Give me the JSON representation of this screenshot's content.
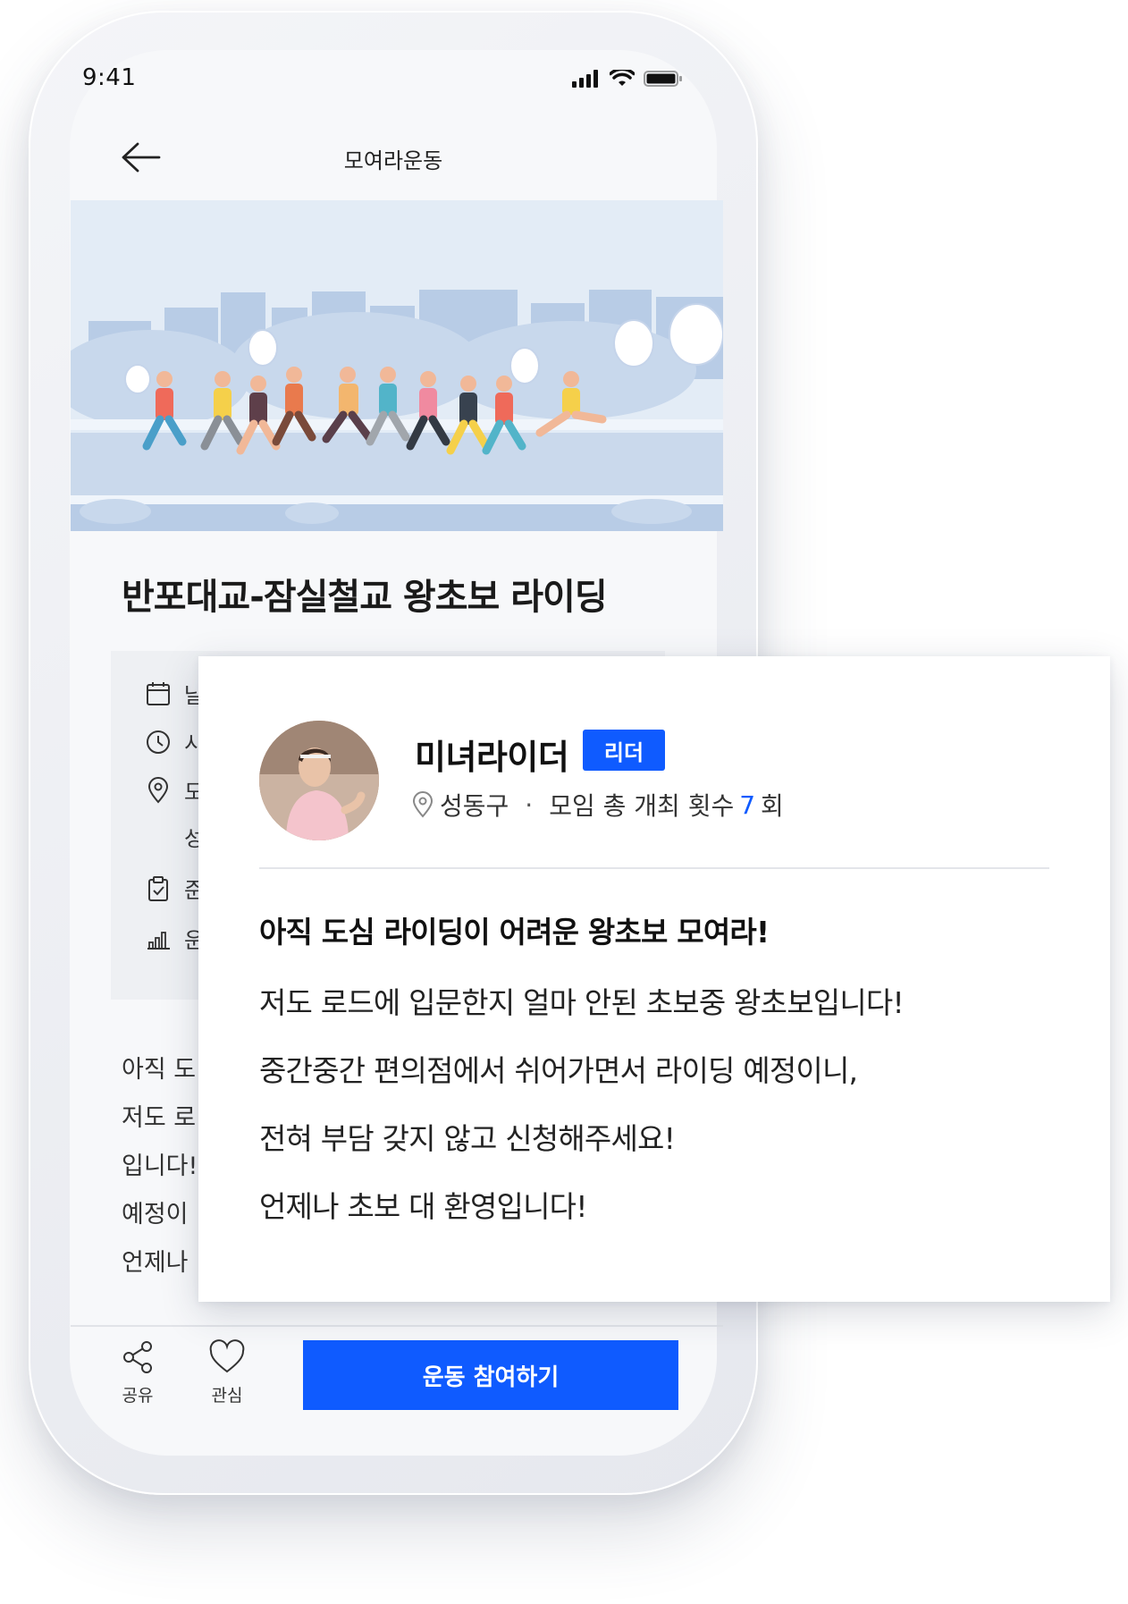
{
  "status": {
    "time": "9:41"
  },
  "header": {
    "title": "모여라운동"
  },
  "event": {
    "title": "반포대교-잠실철교 왕초보 라이딩"
  },
  "info_rows": [
    {
      "icon": "calendar-icon",
      "text": "날"
    },
    {
      "icon": "clock-icon",
      "text": "시"
    },
    {
      "icon": "location-pin-icon",
      "text": "도"
    },
    {
      "icon": "",
      "text": "성"
    },
    {
      "icon": "clipboard-check-icon",
      "text": "준"
    },
    {
      "icon": "level-bars-icon",
      "text": "운"
    }
  ],
  "description_partial": [
    "아직 도",
    "저도 로",
    "입니다!",
    "예정이",
    "언제나"
  ],
  "leader": {
    "name": "미녀라이더",
    "badge": "리더",
    "area": "성동구",
    "separator": "·",
    "meetings_label": "모임 총 개최 횟수",
    "meetings_count": "7",
    "meetings_unit": "회"
  },
  "card": {
    "headline": "아직 도심 라이딩이 어려운 왕초보 모여라!",
    "lines": [
      "저도 로드에 입문한지 얼마 안된 초보중 왕초보입니다!",
      "중간중간 편의점에서 쉬어가면서 라이딩 예정이니,",
      "전혀 부담 갖지 않고 신청해주세요!",
      "언제나 초보 대 환영입니다!"
    ]
  },
  "bottom": {
    "share_label": "공유",
    "like_label": "관심",
    "cta_label": "운동 참여하기"
  },
  "colors": {
    "accent": "#0f5bff",
    "screen_bg": "#f7f8fa",
    "info_bg": "#eef0f3",
    "hero_sky": "#e3ecf6"
  }
}
